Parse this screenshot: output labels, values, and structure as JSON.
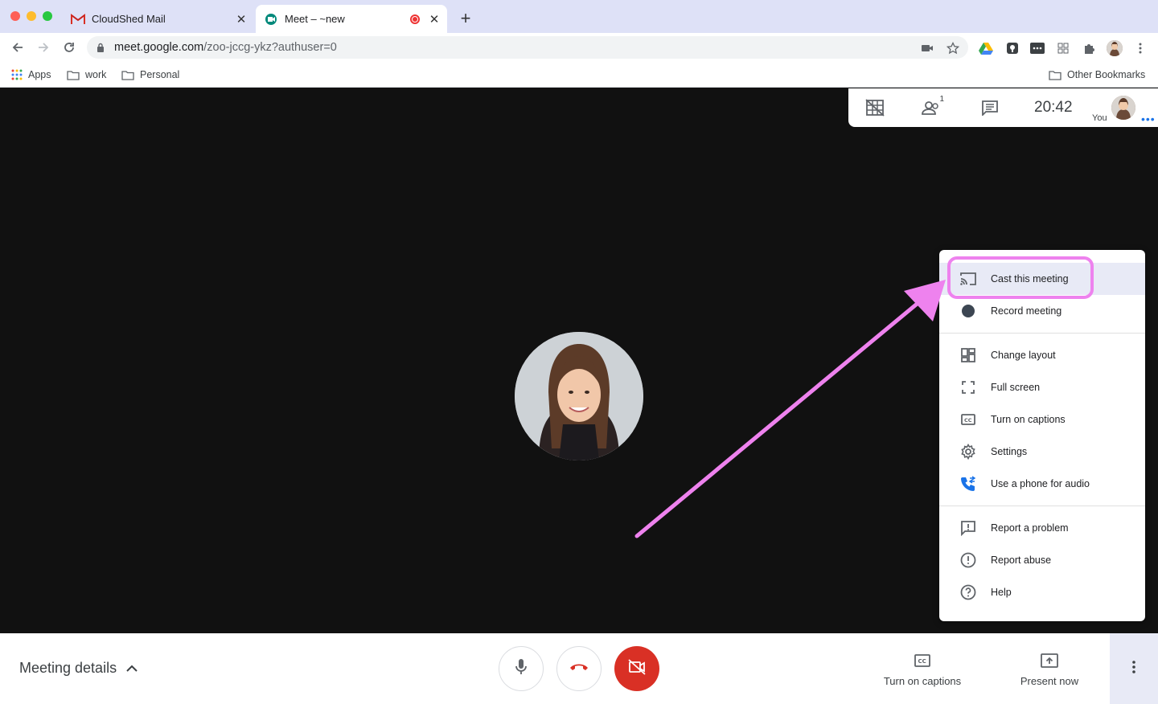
{
  "browser": {
    "tabs": [
      {
        "title": "CloudShed Mail",
        "icon": "gmail-icon"
      },
      {
        "title": "Meet – ~new",
        "icon": "meet-icon"
      }
    ],
    "url_host": "meet.google.com",
    "url_path": "/zoo-jccg-ykz?authuser=0",
    "bookmarks": [
      "Apps",
      "work",
      "Personal"
    ],
    "other_bookmarks": "Other Bookmarks"
  },
  "meet": {
    "clock": "20:42",
    "participant_count": "1",
    "you_label": "You",
    "menu": {
      "items": [
        {
          "label": "Cast this meeting",
          "icon": "cast-icon"
        },
        {
          "label": "Record meeting",
          "icon": "record-icon"
        },
        {
          "label": "Change layout",
          "icon": "layout-icon"
        },
        {
          "label": "Full screen",
          "icon": "fullscreen-icon"
        },
        {
          "label": "Turn on captions",
          "icon": "captions-icon"
        },
        {
          "label": "Settings",
          "icon": "gear-icon"
        },
        {
          "label": "Use a phone for audio",
          "icon": "phone-icon"
        },
        {
          "label": "Report a problem",
          "icon": "feedback-icon"
        },
        {
          "label": "Report abuse",
          "icon": "alert-icon"
        },
        {
          "label": "Help",
          "icon": "help-icon"
        }
      ]
    },
    "bottom": {
      "meeting_details": "Meeting details",
      "captions_label": "Turn on captions",
      "present_label": "Present now"
    }
  },
  "colors": {
    "stage_bg": "#111111",
    "hangup_red": "#d93025",
    "annotation_pink": "#ee82ee",
    "menu_highlight": "#e8eaf6"
  }
}
